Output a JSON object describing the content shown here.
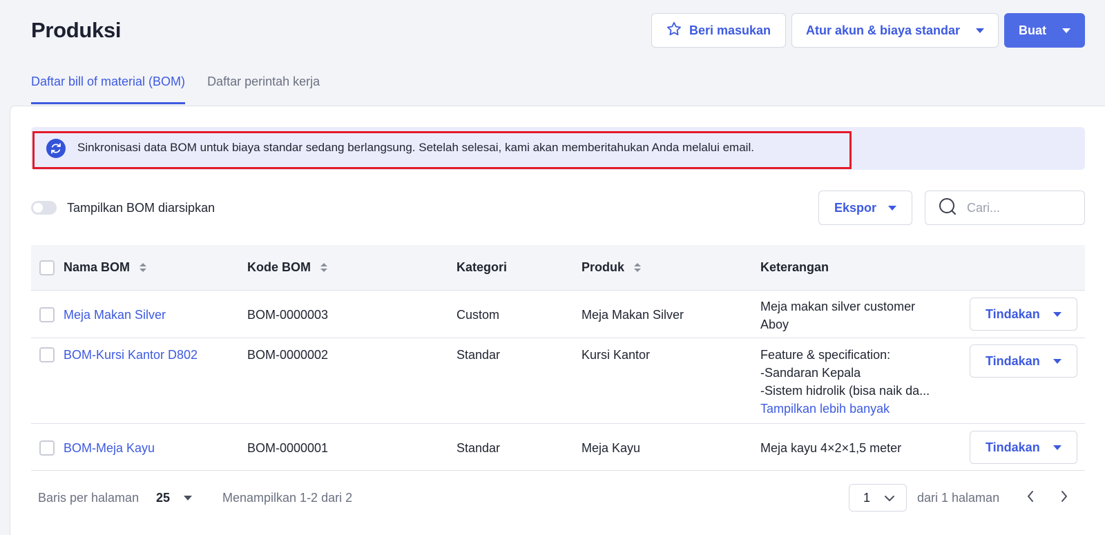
{
  "header": {
    "title": "Produksi",
    "feedback_label": "Beri masukan",
    "settings_label": "Atur akun & biaya standar",
    "create_label": "Buat"
  },
  "tabs": [
    {
      "label": "Daftar bill of material (BOM)",
      "active": true
    },
    {
      "label": "Daftar perintah kerja",
      "active": false
    }
  ],
  "banner": {
    "text": "Sinkronisasi data BOM untuk biaya standar sedang berlangsung. Setelah selesai, kami akan memberitahukan Anda melalui email.",
    "icon": "sync-icon"
  },
  "filters": {
    "archived_toggle_label": "Tampilkan BOM diarsipkan",
    "archived_toggle_on": false,
    "export_label": "Ekspor",
    "search_placeholder": "Cari..."
  },
  "table": {
    "columns": [
      "Nama BOM",
      "Kode BOM",
      "Kategori",
      "Produk",
      "Keterangan"
    ],
    "rows": [
      {
        "name": "Meja Makan Silver",
        "code": "BOM-0000003",
        "category": "Custom",
        "product": "Meja Makan Silver",
        "notes": [
          "Meja makan silver customer",
          "Aboy"
        ],
        "more": "",
        "action": "Tindakan"
      },
      {
        "name": "BOM-Kursi Kantor D802",
        "code": "BOM-0000002",
        "category": "Standar",
        "product": "Kursi Kantor",
        "notes": [
          "Feature & specification:",
          "-Sandaran Kepala",
          "-Sistem hidrolik (bisa naik da..."
        ],
        "more": "Tampilkan lebih banyak",
        "action": "Tindakan"
      },
      {
        "name": "BOM-Meja Kayu",
        "code": "BOM-0000001",
        "category": "Standar",
        "product": "Meja Kayu",
        "notes": [
          "Meja kayu 4×2×1,5 meter"
        ],
        "more": "",
        "action": "Tindakan"
      }
    ]
  },
  "pagination": {
    "rows_per_page_label": "Baris per halaman",
    "rows_per_page": "25",
    "showing": "Menampilkan 1-2 dari 2",
    "current_page": "1",
    "of_pages": "dari 1 halaman"
  },
  "colors": {
    "accent": "#3d5ae0",
    "primary_button": "#4e6be6",
    "banner_bg": "#eaecfb",
    "highlight_outline": "#e5192b"
  }
}
